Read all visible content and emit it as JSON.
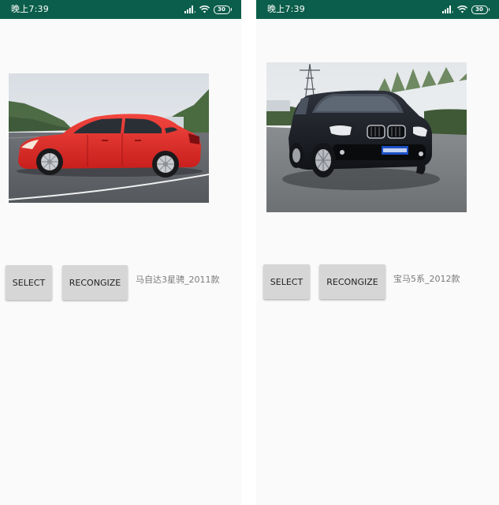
{
  "screens": [
    {
      "status_bar": {
        "time": "晚上7:39",
        "battery": "30"
      },
      "photo": {
        "subject": "red sedan car photo",
        "car_color": "#e8312e"
      },
      "buttons": {
        "select_label": "SELECT",
        "recognize_label": "RECONGIZE"
      },
      "result": "马自达3星骋_2011款"
    },
    {
      "status_bar": {
        "time": "晚上7:39",
        "battery": "30"
      },
      "photo": {
        "subject": "black SUV car photo",
        "car_color": "#1c1f26"
      },
      "buttons": {
        "select_label": "SELECT",
        "recognize_label": "RECONGIZE"
      },
      "result": "宝马5系_2012款"
    }
  ],
  "colors": {
    "status_bar": "#0b5e4b",
    "button_bg": "#d6d6d6",
    "background": "#fafafa"
  }
}
